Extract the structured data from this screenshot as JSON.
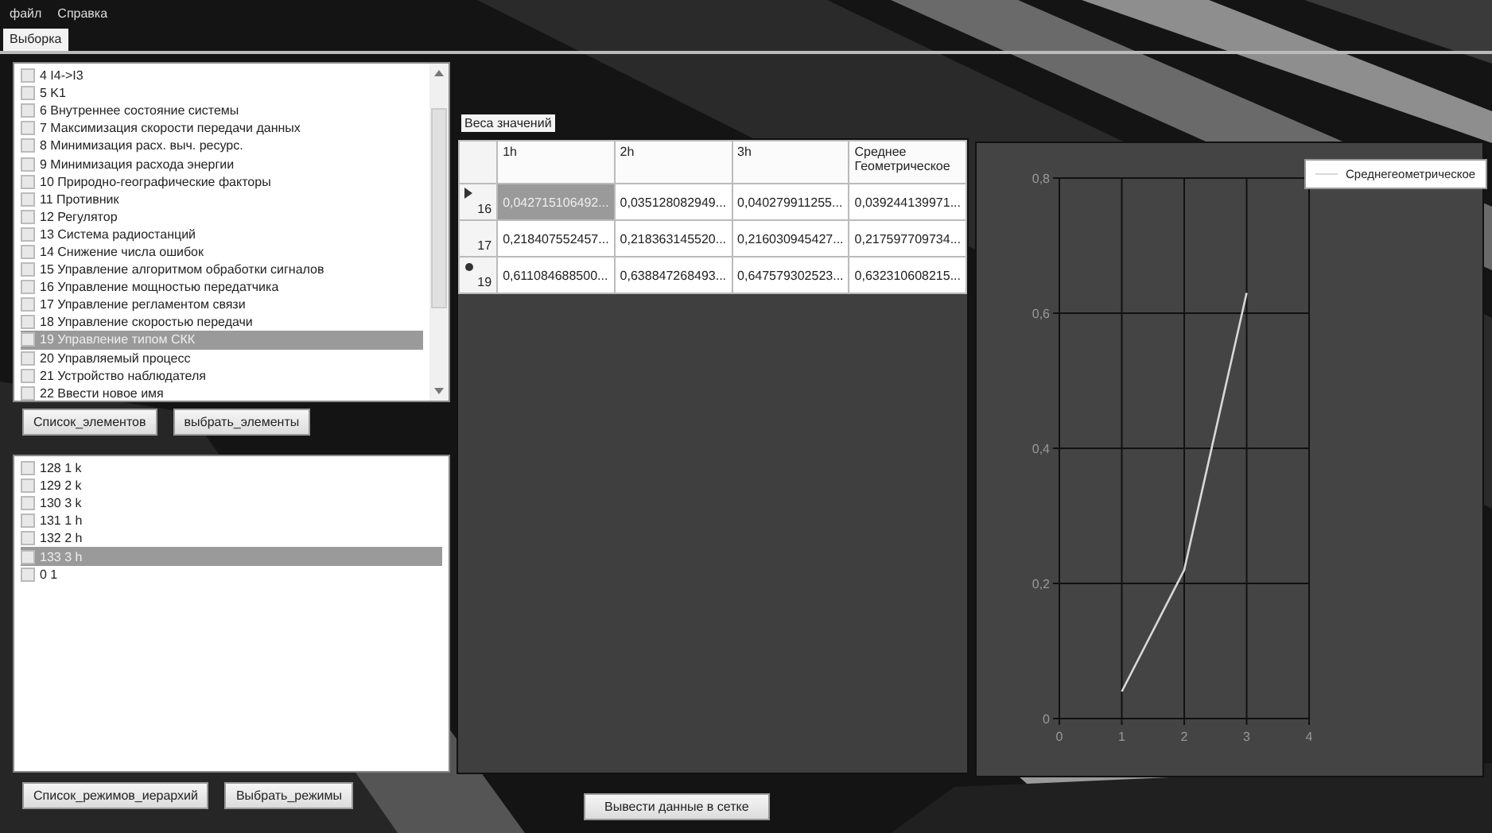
{
  "menu": [
    {
      "label": "файл"
    },
    {
      "label": "Справка"
    }
  ],
  "tabs": [
    {
      "label": "Выборка",
      "selected": true
    }
  ],
  "elements_list": {
    "items": [
      {
        "label": "4 I4->I3",
        "checked": false,
        "selected": false
      },
      {
        "label": "5 K1",
        "checked": false,
        "selected": false
      },
      {
        "label": "6 Внутреннее состояние системы",
        "checked": false,
        "selected": false
      },
      {
        "label": "7 Максимизация скорости передачи данных",
        "checked": false,
        "selected": false
      },
      {
        "label": "8 Минимизация расх. выч. ресурс.",
        "checked": false,
        "selected": false
      },
      {
        "label": "9 Минимизация расхода энергии",
        "checked": false,
        "selected": false
      },
      {
        "label": "10 Природно-географические факторы",
        "checked": false,
        "selected": false
      },
      {
        "label": "11 Противник",
        "checked": false,
        "selected": false
      },
      {
        "label": "12 Регулятор",
        "checked": false,
        "selected": false
      },
      {
        "label": "13 Система радиостанций",
        "checked": false,
        "selected": false
      },
      {
        "label": "14 Снижение числа ошибок",
        "checked": false,
        "selected": false
      },
      {
        "label": "15 Управление алгоритмом обработки сигналов",
        "checked": false,
        "selected": false
      },
      {
        "label": "16 Управление мощностью передатчика",
        "checked": false,
        "selected": false
      },
      {
        "label": "17 Управление регламентом связи",
        "checked": false,
        "selected": false
      },
      {
        "label": "18 Управление скоростью передачи",
        "checked": false,
        "selected": false
      },
      {
        "label": "19 Управление типом СКК",
        "checked": false,
        "selected": true
      },
      {
        "label": "20 Управляемый процесс",
        "checked": false,
        "selected": false
      },
      {
        "label": "21 Устройство наблюдателя",
        "checked": false,
        "selected": false
      },
      {
        "label": "22 Ввести новое имя",
        "checked": false,
        "selected": false
      }
    ]
  },
  "elements_buttons": [
    "Список_элементов",
    "выбрать_элементы"
  ],
  "modes_list": {
    "items": [
      {
        "label": "128 1 k",
        "checked": false,
        "selected": false
      },
      {
        "label": "129 2 k",
        "checked": false,
        "selected": false
      },
      {
        "label": "130 3 k",
        "checked": false,
        "selected": false
      },
      {
        "label": "131 1 h",
        "checked": false,
        "selected": false
      },
      {
        "label": "132 2 h",
        "checked": false,
        "selected": false
      },
      {
        "label": "133 3 h",
        "checked": false,
        "selected": true
      },
      {
        "label": "0 1",
        "checked": false,
        "selected": false
      }
    ]
  },
  "modes_buttons": [
    "Список_режимов_иерархий",
    "Выбрать_режимы"
  ],
  "grid": {
    "title": "Веса значений",
    "columns": [
      "1h",
      "2h",
      "3h",
      "Среднее Геометрическое"
    ],
    "rows": [
      {
        "kind": "current",
        "header": "16",
        "cells": [
          {
            "text": "0,042715106492...",
            "selected": true
          },
          {
            "text": "0,035128082949...",
            "selected": false
          },
          {
            "text": "0,040279911255...",
            "selected": false
          },
          {
            "text": "0,039244139971...",
            "selected": false
          }
        ]
      },
      {
        "kind": "normal",
        "header": "17",
        "cells": [
          {
            "text": "0,218407552457...",
            "selected": false
          },
          {
            "text": "0,218363145520...",
            "selected": false
          },
          {
            "text": "0,216030945427...",
            "selected": false
          },
          {
            "text": "0,217597709734...",
            "selected": false
          }
        ]
      },
      {
        "kind": "new",
        "header": "19",
        "cells": [
          {
            "text": "0,611084688500...",
            "selected": false
          },
          {
            "text": "0,638847268493...",
            "selected": false
          },
          {
            "text": "0,647579302523...",
            "selected": false
          },
          {
            "text": "0,632310608215...",
            "selected": false
          }
        ]
      }
    ]
  },
  "chart": {
    "chart_data": {
      "type": "line",
      "x": [
        1,
        2,
        3
      ],
      "series": [
        {
          "name": "Среднегеометрическое",
          "color": "#d8d8d8",
          "values": [
            0.04,
            0.22,
            0.63
          ]
        }
      ],
      "grid": true,
      "xlim": [
        0,
        4
      ],
      "ylim": [
        0,
        0.8
      ],
      "xticks": [
        0,
        1,
        2,
        3,
        4
      ],
      "yticks": [
        0,
        {
          "value": 0.2,
          "label": "0,2"
        },
        {
          "value": 0.4,
          "label": "0,4"
        },
        {
          "value": 0.6,
          "label": "0,6"
        },
        {
          "value": 0.8,
          "label": "0,8"
        }
      ]
    }
  },
  "show_button": "Вывести данные в сетке"
}
